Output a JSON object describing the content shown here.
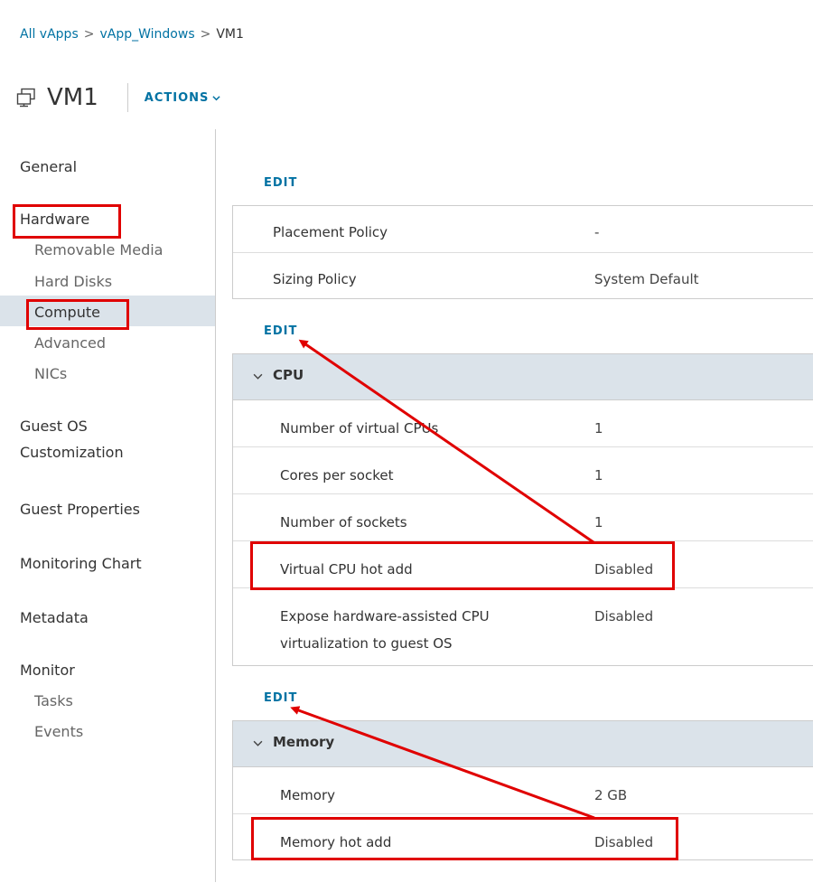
{
  "breadcrumb": [
    "All vApps",
    "vApp_Windows",
    "VM1"
  ],
  "header": {
    "title": "VM1",
    "actions_label": "ACTIONS"
  },
  "nav": {
    "general": "General",
    "hardware": "Hardware",
    "hardware_items": [
      "Removable Media",
      "Hard Disks",
      "Compute",
      "Advanced",
      "NICs"
    ],
    "guest_os_1": "Guest OS",
    "guest_os_2": "Customization",
    "guest_properties": "Guest Properties",
    "monitoring_chart": "Monitoring Chart",
    "metadata": "Metadata",
    "monitor": "Monitor",
    "monitor_items": [
      "Tasks",
      "Events"
    ]
  },
  "edit_label": "EDIT",
  "policies": [
    {
      "label": "Placement Policy",
      "value": "-"
    },
    {
      "label": "Sizing Policy",
      "value": "System Default"
    }
  ],
  "cpu": {
    "title": "CPU",
    "rows": [
      {
        "label": "Number of virtual CPUs",
        "value": "1"
      },
      {
        "label": "Cores per socket",
        "value": "1"
      },
      {
        "label": "Number of sockets",
        "value": "1"
      },
      {
        "label": "Virtual CPU hot add",
        "value": "Disabled"
      },
      {
        "label_line1": "Expose hardware-assisted CPU",
        "label_line2": "virtualization to guest OS",
        "value": "Disabled"
      }
    ]
  },
  "memory": {
    "title": "Memory",
    "rows": [
      {
        "label": "Memory",
        "value": "2 GB"
      },
      {
        "label": "Memory hot add",
        "value": "Disabled"
      }
    ]
  },
  "colors": {
    "link": "#0072a3",
    "annotation": "#e00000",
    "section_bg": "#dbe3ea"
  }
}
